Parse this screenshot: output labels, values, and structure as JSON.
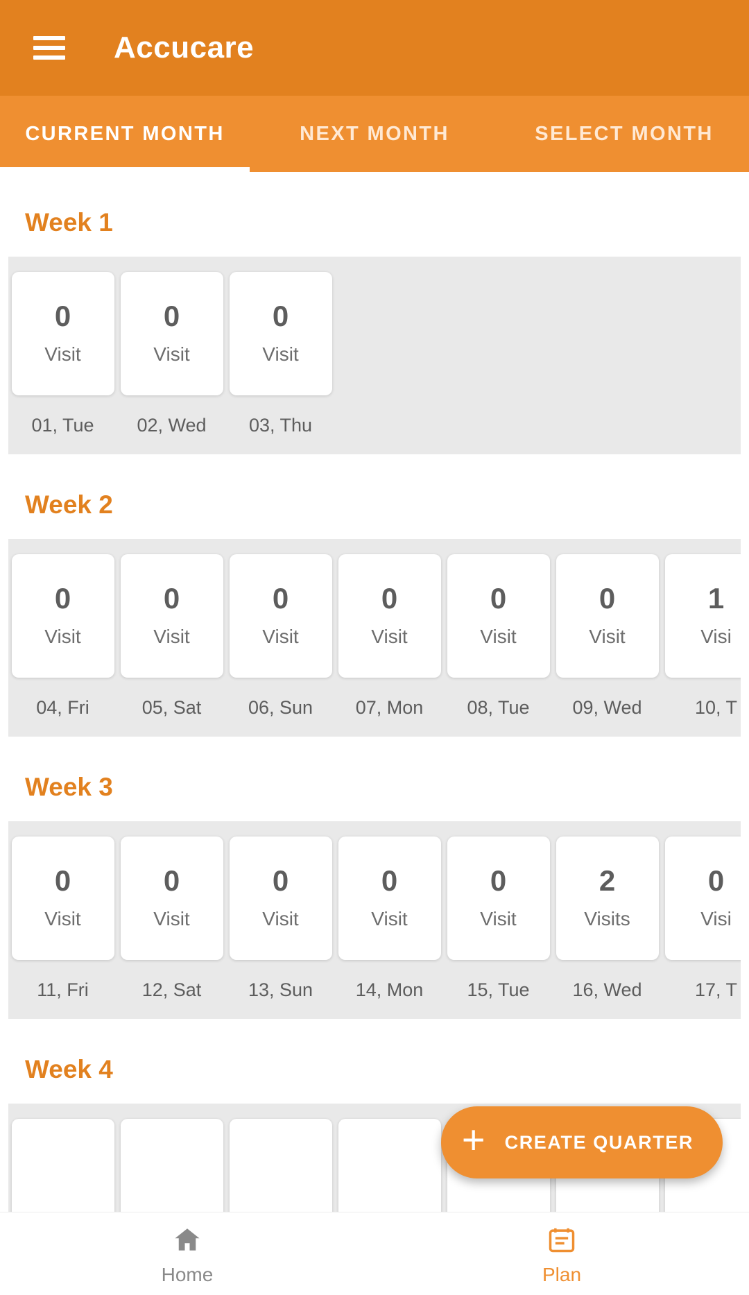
{
  "app": {
    "title": "Accucare",
    "menu_icon": "hamburger-menu-icon",
    "colors": {
      "appbar": "#e2811f",
      "tabbar": "#ef8f31",
      "accent": "#ef8f31",
      "strip_bg": "#e9e9e9",
      "card_bg": "#ffffff",
      "text_muted": "#5d5d5d"
    }
  },
  "tabs": [
    {
      "label": "CURRENT MONTH",
      "active": true
    },
    {
      "label": "NEXT MONTH",
      "active": false
    },
    {
      "label": "SELECT MONTH",
      "active": false
    }
  ],
  "weeks": [
    {
      "title": "Week 1",
      "days": [
        {
          "count": "0",
          "label": "Visit",
          "date": "01, Tue"
        },
        {
          "count": "0",
          "label": "Visit",
          "date": "02, Wed"
        },
        {
          "count": "0",
          "label": "Visit",
          "date": "03, Thu"
        }
      ]
    },
    {
      "title": "Week 2",
      "days": [
        {
          "count": "0",
          "label": "Visit",
          "date": "04, Fri"
        },
        {
          "count": "0",
          "label": "Visit",
          "date": "05, Sat"
        },
        {
          "count": "0",
          "label": "Visit",
          "date": "06, Sun"
        },
        {
          "count": "0",
          "label": "Visit",
          "date": "07, Mon"
        },
        {
          "count": "0",
          "label": "Visit",
          "date": "08, Tue"
        },
        {
          "count": "0",
          "label": "Visit",
          "date": "09, Wed"
        },
        {
          "count": "1",
          "label": "Visi",
          "date": "10, T"
        }
      ]
    },
    {
      "title": "Week 3",
      "days": [
        {
          "count": "0",
          "label": "Visit",
          "date": "11, Fri"
        },
        {
          "count": "0",
          "label": "Visit",
          "date": "12, Sat"
        },
        {
          "count": "0",
          "label": "Visit",
          "date": "13, Sun"
        },
        {
          "count": "0",
          "label": "Visit",
          "date": "14, Mon"
        },
        {
          "count": "0",
          "label": "Visit",
          "date": "15, Tue"
        },
        {
          "count": "2",
          "label": "Visits",
          "date": "16, Wed"
        },
        {
          "count": "0",
          "label": "Visi",
          "date": "17, T"
        }
      ]
    },
    {
      "title": "Week 4",
      "days": [
        {
          "count": "",
          "label": "",
          "date": ""
        },
        {
          "count": "",
          "label": "",
          "date": ""
        },
        {
          "count": "",
          "label": "",
          "date": ""
        },
        {
          "count": "",
          "label": "",
          "date": ""
        },
        {
          "count": "",
          "label": "",
          "date": ""
        },
        {
          "count": "",
          "label": "",
          "date": ""
        },
        {
          "count": "",
          "label": "",
          "date": ""
        }
      ]
    }
  ],
  "fab": {
    "label": "CREATE QUARTER",
    "icon": "plus-icon"
  },
  "bottom_nav": [
    {
      "label": "Home",
      "icon": "home-icon",
      "active": false
    },
    {
      "label": "Plan",
      "icon": "calendar-icon",
      "active": true
    }
  ]
}
